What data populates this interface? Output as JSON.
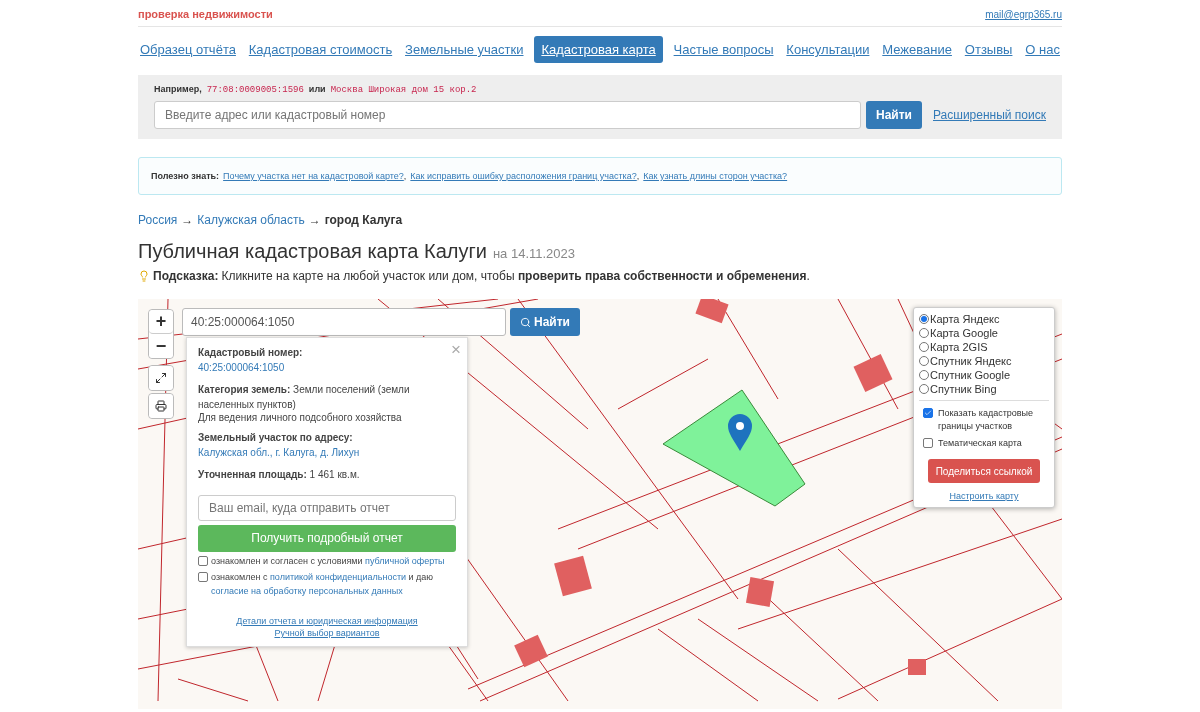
{
  "header": {
    "tagline": "проверка недвижимости",
    "email": "mail@egrp365.ru"
  },
  "nav": [
    {
      "label": "Образец отчёта",
      "selected": false
    },
    {
      "label": "Кадастровая стоимость",
      "selected": false
    },
    {
      "label": "Земельные участки",
      "selected": false
    },
    {
      "label": "Кадастровая карта",
      "selected": true
    },
    {
      "label": "Частые вопросы",
      "selected": false
    },
    {
      "label": "Консультации",
      "selected": false
    },
    {
      "label": "Межевание",
      "selected": false
    },
    {
      "label": "Отзывы",
      "selected": false
    },
    {
      "label": "О нас",
      "selected": false
    }
  ],
  "search": {
    "example_label": "Например,",
    "example_1": "77:08:0009005:1596",
    "example_or": "или",
    "example_2": "Москва Широкая дом 15 кор.2",
    "placeholder": "Введите адрес или кадастровый номер",
    "button": "Найти",
    "advanced_link": "Расширенный поиск"
  },
  "info": {
    "label": "Полезно знать:",
    "links": [
      {
        "text": "Почему участка нет на кадастровой карте?",
        "separator": ","
      },
      {
        "text": "Как исправить ошибку расположения границ участка?",
        "separator": ","
      },
      {
        "text": "Как узнать длины сторон участка?"
      }
    ]
  },
  "breadcrumbs": [
    {
      "label": "Россия",
      "kind": "link",
      "separator": "→"
    },
    {
      "label": "Калужская область",
      "kind": "link",
      "separator": "→"
    },
    {
      "label": "город Калуга",
      "kind": "current"
    }
  ],
  "title": {
    "text": "Публичная кадастровая карта Калуги",
    "date": "на 14.11.2023"
  },
  "hint": {
    "label": "Подсказка:",
    "text": "Кликните на карте на любой участок или дом, чтобы **проверить права собственности и обременения**."
  },
  "map": {
    "zoom_in": "+",
    "zoom_out": "−",
    "search_value": "40:25:000064:1050",
    "search_button": "Найти",
    "popup": {
      "close": "×",
      "fields": [
        {
          "label": "Кадастровый номер:",
          "value": "40:25:000064:1050",
          "kind": "link"
        },
        {
          "label": "Категория земель:",
          "value": "Земли поселений (земли населенных пунктов)",
          "kind": "text",
          "note": "Для ведения личного подсобного хозяйства"
        },
        {
          "label": "Земельный участок по адресу:",
          "value": "Калужская обл., г. Калуга, д. Лихун",
          "kind": "link"
        },
        {
          "label": "Уточненная площадь:",
          "value": "1 461 кв.м.",
          "kind": "text"
        }
      ],
      "email_placeholder": "Ваш email, куда отправить отчет",
      "report_button": "Получить подробный отчет",
      "agreements": [
        {
          "checked": false,
          "segments": [
            {
              "kind": "text",
              "text": "ознакомлен и согласен с условиями "
            },
            {
              "kind": "link",
              "text": "публичной оферты"
            }
          ]
        },
        {
          "checked": false,
          "segments": [
            {
              "kind": "text",
              "text": "ознакомлен с "
            },
            {
              "kind": "link",
              "text": "политикой конфиденциальности"
            },
            {
              "kind": "text",
              "text": " и даю "
            },
            {
              "kind": "link",
              "text": "согласие на обработку персональных данных"
            }
          ]
        }
      ],
      "footer_links": [
        "Детали отчета и юридическая информация",
        "Ручной выбор вариантов"
      ]
    },
    "layers": {
      "options": [
        {
          "label": "Карта Яндекс",
          "selected": true
        },
        {
          "label": "Карта Google",
          "selected": false
        },
        {
          "label": "Карта 2GIS",
          "selected": false
        },
        {
          "label": "Спутник Яндекс",
          "selected": false
        },
        {
          "label": "Спутник Google",
          "selected": false
        },
        {
          "label": "Спутник Bing",
          "selected": false
        }
      ],
      "checks": [
        {
          "label": "Показать кадастровые границы участков",
          "checked": true
        },
        {
          "label": "Тематическая карта",
          "checked": false
        }
      ],
      "share_button": "Поделиться ссылкой",
      "settings_link": "Настроить карту"
    }
  }
}
